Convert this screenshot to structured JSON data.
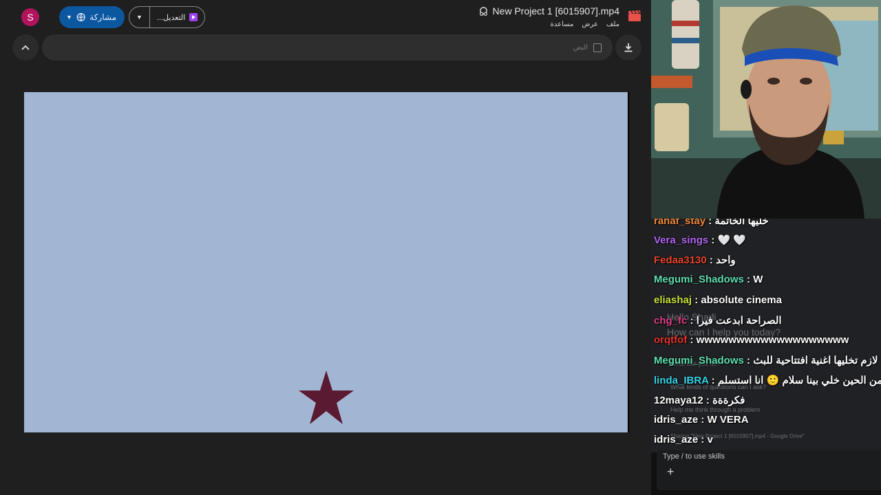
{
  "drive": {
    "avatar_letter": "S",
    "share_label": "مشاركة",
    "edit_label": "التعديل...",
    "title": "New Project 1 [6015907].mp4",
    "menu": [
      "ملف",
      "عرض",
      "مساعدة"
    ],
    "search_placeholder": "النص",
    "icons": {
      "share": "globe-icon",
      "edit": "video-editor-icon",
      "title_status": "shared-drive-icon",
      "app": "clapperboard-icon",
      "collapse": "chevron-up-icon",
      "download": "download-icon"
    },
    "colors": {
      "video_bg": "#a2b5d3",
      "star": "#5a1a32",
      "share_btn": "#0b57a0"
    }
  },
  "chat": {
    "messages": [
      {
        "user": "rahaf_stay",
        "text": "خليها الخاتمة",
        "color": "#f08a3a"
      },
      {
        "user": "Vera_sings",
        "text": "🤍 🤍",
        "color": "#b366f5"
      },
      {
        "user": "Fedaa3130",
        "text": "واحد",
        "color": "#e8452c"
      },
      {
        "user": "Megumi_Shadows",
        "text": "W",
        "color": "#5fe0b0"
      },
      {
        "user": "eliashaj",
        "text": "absolute cinema",
        "color": "#c8e03a"
      },
      {
        "user": "chg_fc",
        "text": "الصراحة ابدعت فيرا",
        "color": "#e0408a"
      },
      {
        "user": "orqtfof",
        "text": "wwwwwwwwwwwwwwwwwww",
        "color": "#e5362c"
      },
      {
        "user": "Megumi_Shadows",
        "text": "لازم تخليها اغنية افتتاحية للبث",
        "color": "#5fe0b0"
      },
      {
        "user": "linda_IBRA",
        "text": "فيرا من الحين خلي بينا سلام 🙂 انا استسلم",
        "color": "#35d6e8"
      },
      {
        "user": "12maya12",
        "text": "فكرةةة",
        "color": "#ffffff"
      },
      {
        "user": "idris_aze",
        "text": "W VERA",
        "color": "#ffffff"
      },
      {
        "user": "idris_aze",
        "text": "v",
        "color": "#ffffff"
      }
    ]
  },
  "assistant": {
    "greeting_line1": "Hello Shadi",
    "greeting_line2": "How can I help you today?",
    "suggestions": [
      "What can you do?",
      "What kinds of questions can I ask?",
      "Help me think through a problem"
    ],
    "sharing": "Sharing \"New Project 1 [6015907].mp4 - Google Drive\"",
    "input_prompt": "Type / to use skills",
    "plus_icon": "plus-icon"
  }
}
